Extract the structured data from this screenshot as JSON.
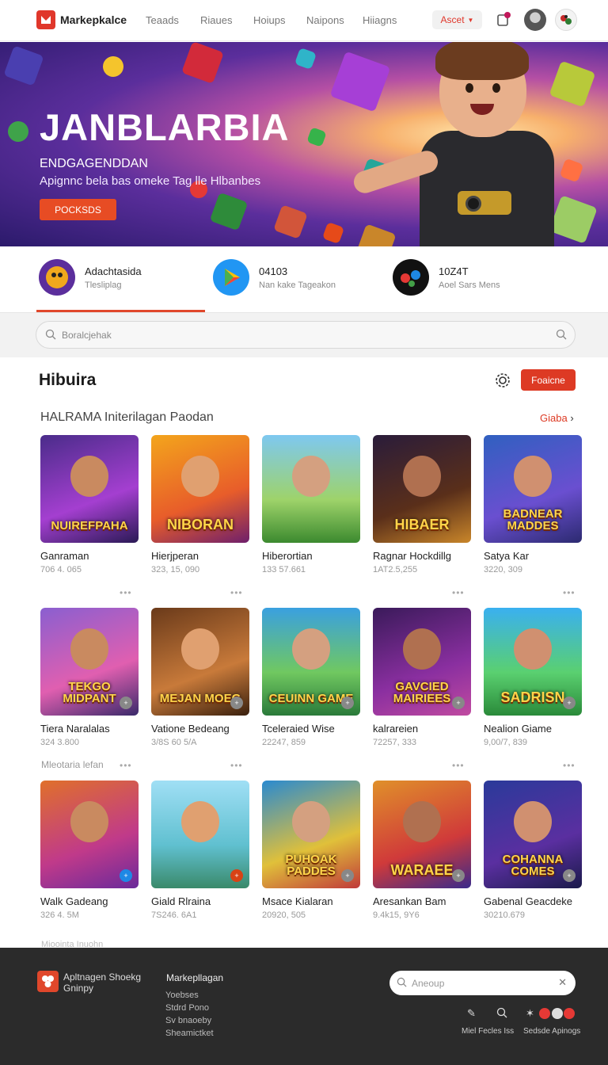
{
  "nav": {
    "brand": "Markepkalce",
    "links": [
      "Teaads",
      "Riaues",
      "Hoiups",
      "Naipons",
      "Hiiagns"
    ],
    "asset_label": "Ascet",
    "logo_icon": "play-logo-icon",
    "accent": "#e0372b"
  },
  "hero": {
    "title": "JANBLARBIA",
    "subtitle": "ENDGAGENDDAN",
    "description": "Apignnc bela bas omeke Tag lle Hlbanbes",
    "cta": "POCKSDS"
  },
  "stats": [
    {
      "title": "Adachtasida",
      "sub": "Tlesliplag",
      "icon": "mascot-icon"
    },
    {
      "title": "04103",
      "sub": "Nan kake Tageakon",
      "icon": "play-store-icon"
    },
    {
      "title": "10Z4T",
      "sub": "Aoel Sars Mens",
      "icon": "game-pieces-icon"
    }
  ],
  "search": {
    "placeholder": "Boralcjehak"
  },
  "section": {
    "title": "Hibuira",
    "button": "Foaicne",
    "subtitle": "HALRAMA Initerilagan Paodan",
    "see_all": "Giaba"
  },
  "cards": [
    {
      "name": "Ganraman",
      "meta": "706 4. 065",
      "label": "NUIREFPAHA"
    },
    {
      "name": "Hierjperan",
      "meta": "323, 15, 090",
      "label": "NIBORAN"
    },
    {
      "name": "Hiberortian",
      "meta": "133 57.661",
      "label": ""
    },
    {
      "name": "Ragnar Hockdillg",
      "meta": "1AT2.5,255",
      "label": "HIBAER"
    },
    {
      "name": "Satya Kar",
      "meta": "3220, 309",
      "label": "BADNEAR MADDES"
    },
    {
      "name": "Tiera Naralalas",
      "meta": "324 3.800",
      "label": "TEKGO MIDPANT"
    },
    {
      "name": "Vatione Bedeang",
      "meta": "3/8S 60 5/A",
      "label": "MEJAN MOEG"
    },
    {
      "name": "Tceleraied Wise",
      "meta": "22247, 859",
      "label": "CEUINN GAME"
    },
    {
      "name": "kalrareien",
      "meta": "72257, 333",
      "label": "GAVCIED MAIRIEES"
    },
    {
      "name": "Nealion Giame",
      "meta": "9,00/7, 839",
      "label": "SADRISN"
    },
    {
      "name": "Walk Gadeang",
      "meta": "326 4. 5M",
      "label": ""
    },
    {
      "name": "Giald Rlraina",
      "meta": "7S246. 6A1",
      "label": ""
    },
    {
      "name": "Msace Kialaran",
      "meta": "20920, 505",
      "label": "PUHOAK PADDES"
    },
    {
      "name": "Aresankan Bam",
      "meta": "9.4k15, 9Y6",
      "label": "WARAEE"
    },
    {
      "name": "Gabenal Geacdeke",
      "meta": "30210.679",
      "label": "COHANNA COMES"
    }
  ],
  "row_note": "Mleotaria lefan",
  "row_note2": "Mioointa Inuohn",
  "footer": {
    "brand": "Apltnagen Shoekg Gninpy",
    "col_title": "Markepllagan",
    "links": [
      "Yoebses",
      "Stdrd Pono",
      "Sv bnaoeby",
      "Sheamictket"
    ],
    "search_placeholder": "Aneoup",
    "left_label": "Miel Fecles Iss",
    "right_label": "Sedsde Apinogs"
  }
}
